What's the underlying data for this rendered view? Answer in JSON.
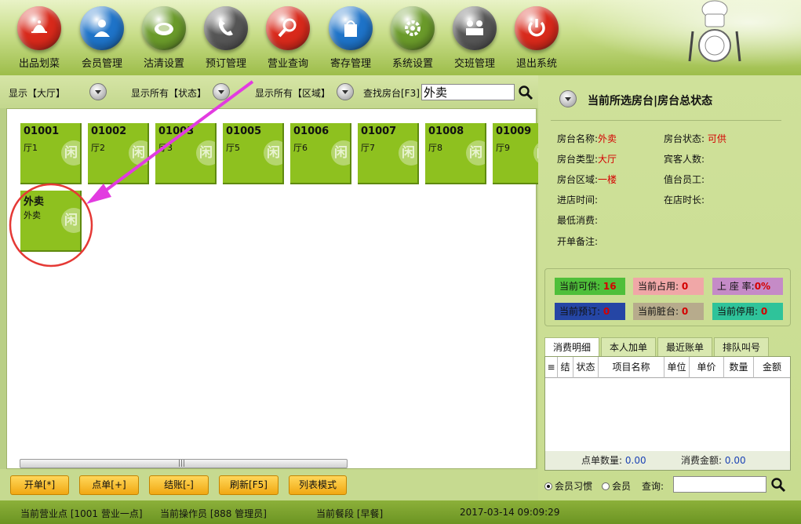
{
  "toolbar": {
    "items": [
      {
        "label": "出品划菜",
        "icon": "dish-cover-icon",
        "color": "#d8291b"
      },
      {
        "label": "会员管理",
        "icon": "member-icon",
        "color": "#1e73c8"
      },
      {
        "label": "沽清设置",
        "icon": "plate-icon",
        "color": "#6a9a2a"
      },
      {
        "label": "预订管理",
        "icon": "phone-icon",
        "color": "#555555"
      },
      {
        "label": "营业查询",
        "icon": "magnifier-icon",
        "color": "#d8291b"
      },
      {
        "label": "寄存管理",
        "icon": "bag-icon",
        "color": "#1e73c8"
      },
      {
        "label": "系统设置",
        "icon": "gear-icon",
        "color": "#6a9a2a"
      },
      {
        "label": "交班管理",
        "icon": "handover-icon",
        "color": "#555555"
      },
      {
        "label": "退出系统",
        "icon": "power-icon",
        "color": "#d8291b"
      }
    ]
  },
  "filters": {
    "display_hall": "显示【大厅】",
    "display_status": "显示所有【状态】",
    "display_area": "显示所有【区域】",
    "search_label": "查找房台[F3]",
    "search_value": "外卖"
  },
  "tables": [
    {
      "code": "01001",
      "name": "厅1",
      "status": "闲"
    },
    {
      "code": "01002",
      "name": "厅2",
      "status": "闲"
    },
    {
      "code": "01003",
      "name": "厅3",
      "status": "闲"
    },
    {
      "code": "01005",
      "name": "厅5",
      "status": "闲"
    },
    {
      "code": "01006",
      "name": "厅6",
      "status": "闲"
    },
    {
      "code": "01007",
      "name": "厅7",
      "status": "闲"
    },
    {
      "code": "01008",
      "name": "厅8",
      "status": "闲"
    },
    {
      "code": "01009",
      "name": "厅9",
      "status": "闲"
    },
    {
      "code": "外卖",
      "name": "外卖",
      "status": "闲"
    }
  ],
  "bottom_buttons": {
    "open": "开单[*]",
    "order": "点单[+]",
    "checkout": "结账[-]",
    "refresh": "刷新[F5]",
    "list_mode": "列表模式"
  },
  "right_panel": {
    "title": "当前所选房台|房台总状态",
    "info": {
      "name_label": "房台名称:",
      "name_value": "外卖",
      "status_label": "房台状态:",
      "status_value": "可供",
      "type_label": "房台类型:",
      "type_value": "大厅",
      "guests_label": "宾客人数:",
      "area_label": "房台区域:",
      "area_value": "一楼",
      "staff_label": "值台员工:",
      "enter_time_label": "进店时间:",
      "duration_label": "在店时长:",
      "min_spend_label": "最低消费:",
      "remark_label": "开单备注:"
    },
    "stats": {
      "available_label": "当前可供:",
      "available_value": "16",
      "occupied_label": "当前占用:",
      "occupied_value": "0",
      "seat_rate_label": "上 座 率:",
      "seat_rate_value": "0%",
      "reserved_label": "当前预订:",
      "reserved_value": "0",
      "dirty_label": "当前脏台:",
      "dirty_value": "0",
      "disabled_label": "当前停用:",
      "disabled_value": "0"
    },
    "stat_colors": {
      "available": "#4fbf3a",
      "occupied": "#f0a7a7",
      "seat_rate": "#c58bc7",
      "reserved": "#2546a5",
      "dirty": "#b7ab8c",
      "disabled": "#2fc39a"
    },
    "tabs": [
      "消费明细",
      "本人加单",
      "最近账单",
      "排队叫号"
    ],
    "grid_columns": [
      "结",
      "状态",
      "项目名称",
      "单位",
      "单价",
      "数量",
      "金额"
    ],
    "footer": {
      "count_label": "点单数量:",
      "count_value": "0.00",
      "amount_label": "消费金额:",
      "amount_value": "0.00"
    },
    "radios": {
      "habit": "会员习惯",
      "member": "会员"
    },
    "query_label": "查询:"
  },
  "status_bar": {
    "outlet": "当前营业点 [1001 营业一点]",
    "operator": "当前操作员 [888 管理员]",
    "meal": "当前餐段 [早餐]",
    "time": "2017-03-14 09:09:29"
  }
}
